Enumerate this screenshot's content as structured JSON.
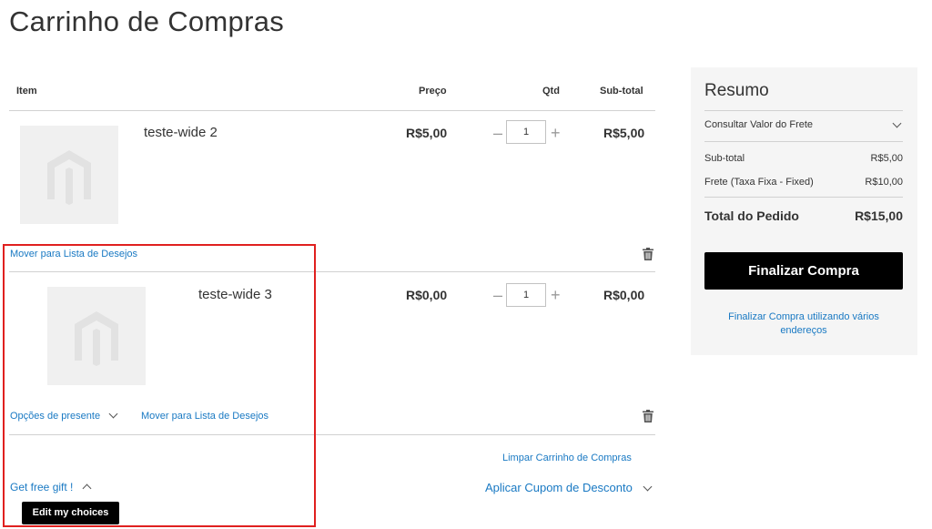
{
  "page": {
    "title": "Carrinho de Compras"
  },
  "table": {
    "headers": {
      "item": "Item",
      "price": "Preço",
      "qty": "Qtd",
      "subtotal": "Sub-total"
    }
  },
  "items": [
    {
      "name": "teste-wide 2",
      "price": "R$5,00",
      "qty": "1",
      "subtotal": "R$5,00",
      "wishlist_label": "Mover para Lista de Desejos"
    },
    {
      "name": "teste-wide 3",
      "price": "R$0,00",
      "qty": "1",
      "subtotal": "R$0,00",
      "gift_options_label": "Opções de presente",
      "wishlist_label": "Mover para Lista de Desejos"
    }
  ],
  "cart_actions": {
    "clear_cart": "Limpar Carrinho de Compras",
    "free_gift": "Get free gift !",
    "edit_choices": "Edit my choices",
    "apply_coupon": "Aplicar Cupom de Desconto"
  },
  "summary": {
    "title": "Resumo",
    "shipping_estimate": "Consultar Valor do Frete",
    "subtotal_label": "Sub-total",
    "subtotal_value": "R$5,00",
    "shipping_label": "Frete (Taxa Fixa - Fixed)",
    "shipping_value": "R$10,00",
    "total_label": "Total do Pedido",
    "total_value": "R$15,00",
    "checkout_button": "Finalizar Compra",
    "multi_address_link": "Finalizar Compra utilizando vários endereços"
  },
  "icons": {
    "placeholder": "magento-logo-placeholder",
    "delete": "trash-icon",
    "minus": "minus-icon",
    "plus": "plus-icon",
    "chevron": "chevron-down-icon"
  },
  "colors": {
    "link": "#1979c3",
    "primary_button": "#000000",
    "highlight_border": "#e0201f",
    "summary_bg": "#f5f5f5"
  }
}
